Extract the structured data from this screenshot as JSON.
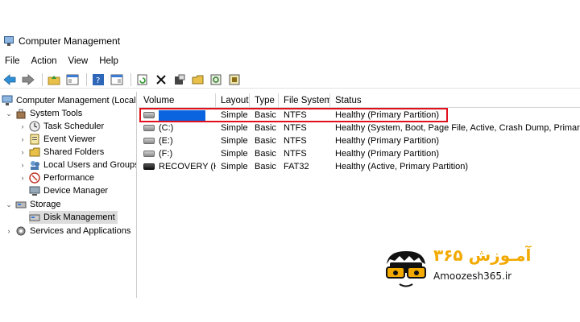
{
  "window": {
    "title": "Computer Management"
  },
  "menu": {
    "items": [
      "File",
      "Action",
      "View",
      "Help"
    ]
  },
  "toolbar": {
    "buttons": [
      "back-icon",
      "forward-icon",
      "up-folder-icon",
      "show-hide-tree-icon",
      "help-icon",
      "properties-pane-icon",
      "refresh-icon",
      "delete-icon",
      "properties-icon",
      "open-icon",
      "search-icon",
      "export-icon"
    ]
  },
  "tree": {
    "root": "Computer Management (Local",
    "system_tools": "System Tools",
    "task_scheduler": "Task Scheduler",
    "event_viewer": "Event Viewer",
    "shared_folders": "Shared Folders",
    "local_users": "Local Users and Groups",
    "performance": "Performance",
    "device_manager": "Device Manager",
    "storage": "Storage",
    "disk_management": "Disk Management",
    "services": "Services and Applications"
  },
  "table": {
    "headers": {
      "volume": "Volume",
      "layout": "Layout",
      "type": "Type",
      "fs": "File System",
      "status": "Status"
    },
    "rows": [
      {
        "volume": "",
        "layout": "Simple",
        "type": "Basic",
        "fs": "NTFS",
        "status": "Healthy (Primary Partition)"
      },
      {
        "volume": "(C:)",
        "layout": "Simple",
        "type": "Basic",
        "fs": "NTFS",
        "status": "Healthy (System, Boot, Page File, Active, Crash Dump, Primary"
      },
      {
        "volume": "(E:)",
        "layout": "Simple",
        "type": "Basic",
        "fs": "NTFS",
        "status": "Healthy (Primary Partition)"
      },
      {
        "volume": "(F:)",
        "layout": "Simple",
        "type": "Basic",
        "fs": "NTFS",
        "status": "Healthy (Primary Partition)"
      },
      {
        "volume": "RECOVERY (H:)",
        "layout": "Simple",
        "type": "Basic",
        "fs": "FAT32",
        "status": "Healthy (Active, Primary Partition)"
      }
    ]
  },
  "watermark": {
    "text": "Amoozesh365.ir",
    "native_text": "آمـوزش ۳۶۵"
  },
  "colors": {
    "highlight": "#0a64e0",
    "red_box": "#e0101c",
    "logo_accent": "#f2a900"
  }
}
